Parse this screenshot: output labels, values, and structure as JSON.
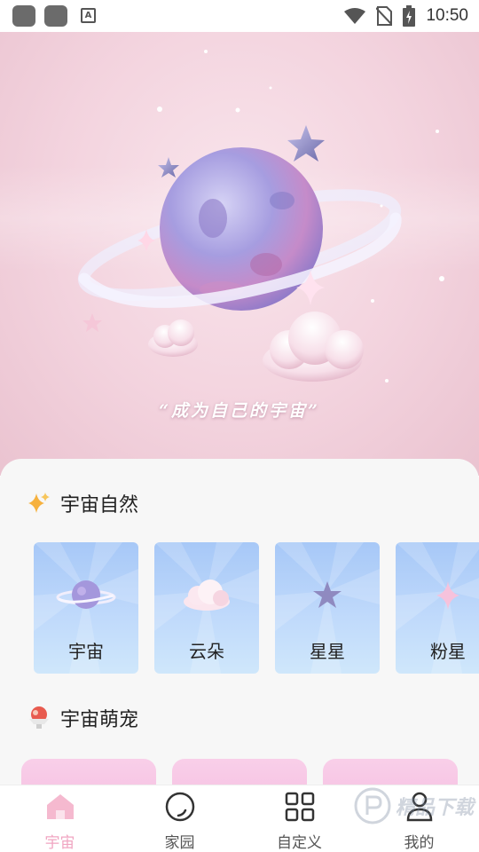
{
  "status_bar": {
    "time": "10:50",
    "notif_letter": "A"
  },
  "hero": {
    "quote": "“成为自己的宇宙”"
  },
  "sections": [
    {
      "title": "宇宙自然",
      "icon": "sparkle-icon",
      "cards": [
        {
          "label": "宇宙",
          "icon": "planet-icon"
        },
        {
          "label": "云朵",
          "icon": "cloud-icon"
        },
        {
          "label": "星星",
          "icon": "star-icon"
        },
        {
          "label": "粉星",
          "icon": "pink-sparkle-icon"
        }
      ]
    },
    {
      "title": "宇宙萌宠",
      "icon": "shaved-ice-icon"
    }
  ],
  "tabs": [
    {
      "label": "宇宙",
      "icon": "home-icon",
      "active": true
    },
    {
      "label": "家园",
      "icon": "circle-icon",
      "active": false
    },
    {
      "label": "自定义",
      "icon": "grid-icon",
      "active": false
    },
    {
      "label": "我的",
      "icon": "user-icon",
      "active": false
    }
  ],
  "watermark": {
    "text": "精品下载",
    "brand": "P"
  },
  "colors": {
    "accent": "#f0a6c2",
    "card_blue": "#a7c8f7",
    "pet_pink": "#f9cfe9",
    "hero_pink": "#f3d3de"
  }
}
